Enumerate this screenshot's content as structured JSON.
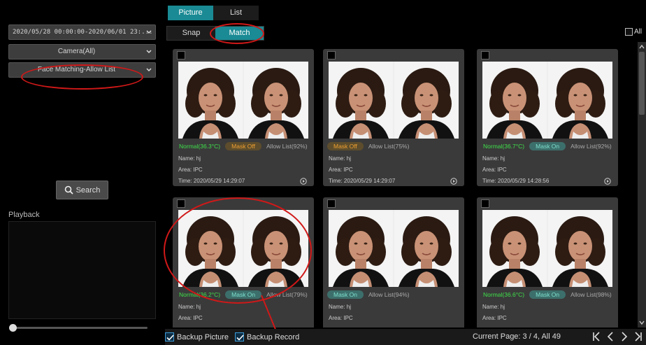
{
  "filters": {
    "time_range": "2020/05/28 00:00:00-2020/06/01 23:...",
    "camera": "Camera(All)",
    "event_type": "Face Matching-Allow List",
    "search_label": "Search",
    "playback_label": "Playback"
  },
  "tabs": {
    "view": [
      {
        "label": "Picture",
        "active": true
      },
      {
        "label": "List",
        "active": false
      }
    ],
    "mode": [
      {
        "label": "Snap",
        "active": false
      },
      {
        "label": "Match",
        "active": true
      }
    ],
    "all_label": "All"
  },
  "cards": [
    {
      "tags": [
        {
          "text": "Normal(36.3°C)",
          "style": "green"
        },
        {
          "text": "Mask Off",
          "style": "orange"
        },
        {
          "text": "Allow List(92%)",
          "style": "grey"
        }
      ],
      "name": "Name:  hj",
      "area": "Area:  IPC",
      "time": "Time:  2020/05/29 14:29:07"
    },
    {
      "tags": [
        {
          "text": "Mask Off",
          "style": "orange"
        },
        {
          "text": "Allow List(75%)",
          "style": "grey"
        }
      ],
      "name": "Name:  hj",
      "area": "Area:  IPC",
      "time": "Time:  2020/05/29 14:29:07"
    },
    {
      "tags": [
        {
          "text": "Normal(36.7°C)",
          "style": "green"
        },
        {
          "text": "Mask On",
          "style": "teal"
        },
        {
          "text": "Allow List(92%)",
          "style": "grey"
        }
      ],
      "name": "Name:  hj",
      "area": "Area:  IPC",
      "time": "Time:  2020/05/29 14:28:56"
    },
    {
      "tags": [
        {
          "text": "Normal(36.2°C)",
          "style": "green"
        },
        {
          "text": "Mask On",
          "style": "teal"
        },
        {
          "text": "Allow List(79%)",
          "style": "grey"
        }
      ],
      "name": "Name:  hj",
      "area": "Area:  IPC",
      "time": ""
    },
    {
      "tags": [
        {
          "text": "Mask On",
          "style": "teal"
        },
        {
          "text": "Allow List(94%)",
          "style": "grey"
        }
      ],
      "name": "Name:  hj",
      "area": "Area:  IPC",
      "time": ""
    },
    {
      "tags": [
        {
          "text": "Normal(36.6°C)",
          "style": "green"
        },
        {
          "text": "Mask On",
          "style": "teal"
        },
        {
          "text": "Allow List(98%)",
          "style": "grey"
        }
      ],
      "name": "Name:  hj",
      "area": "Area:  IPC",
      "time": ""
    }
  ],
  "bottom": {
    "backup_picture": "Backup Picture",
    "backup_record": "Backup Record",
    "page_info": "Current Page: 3 / 4, All 49"
  },
  "colors": {
    "accent": "#1a8a94",
    "annotation": "#d01818",
    "normal_temp": "#3ee04a",
    "mask_off": "#f0a030"
  }
}
